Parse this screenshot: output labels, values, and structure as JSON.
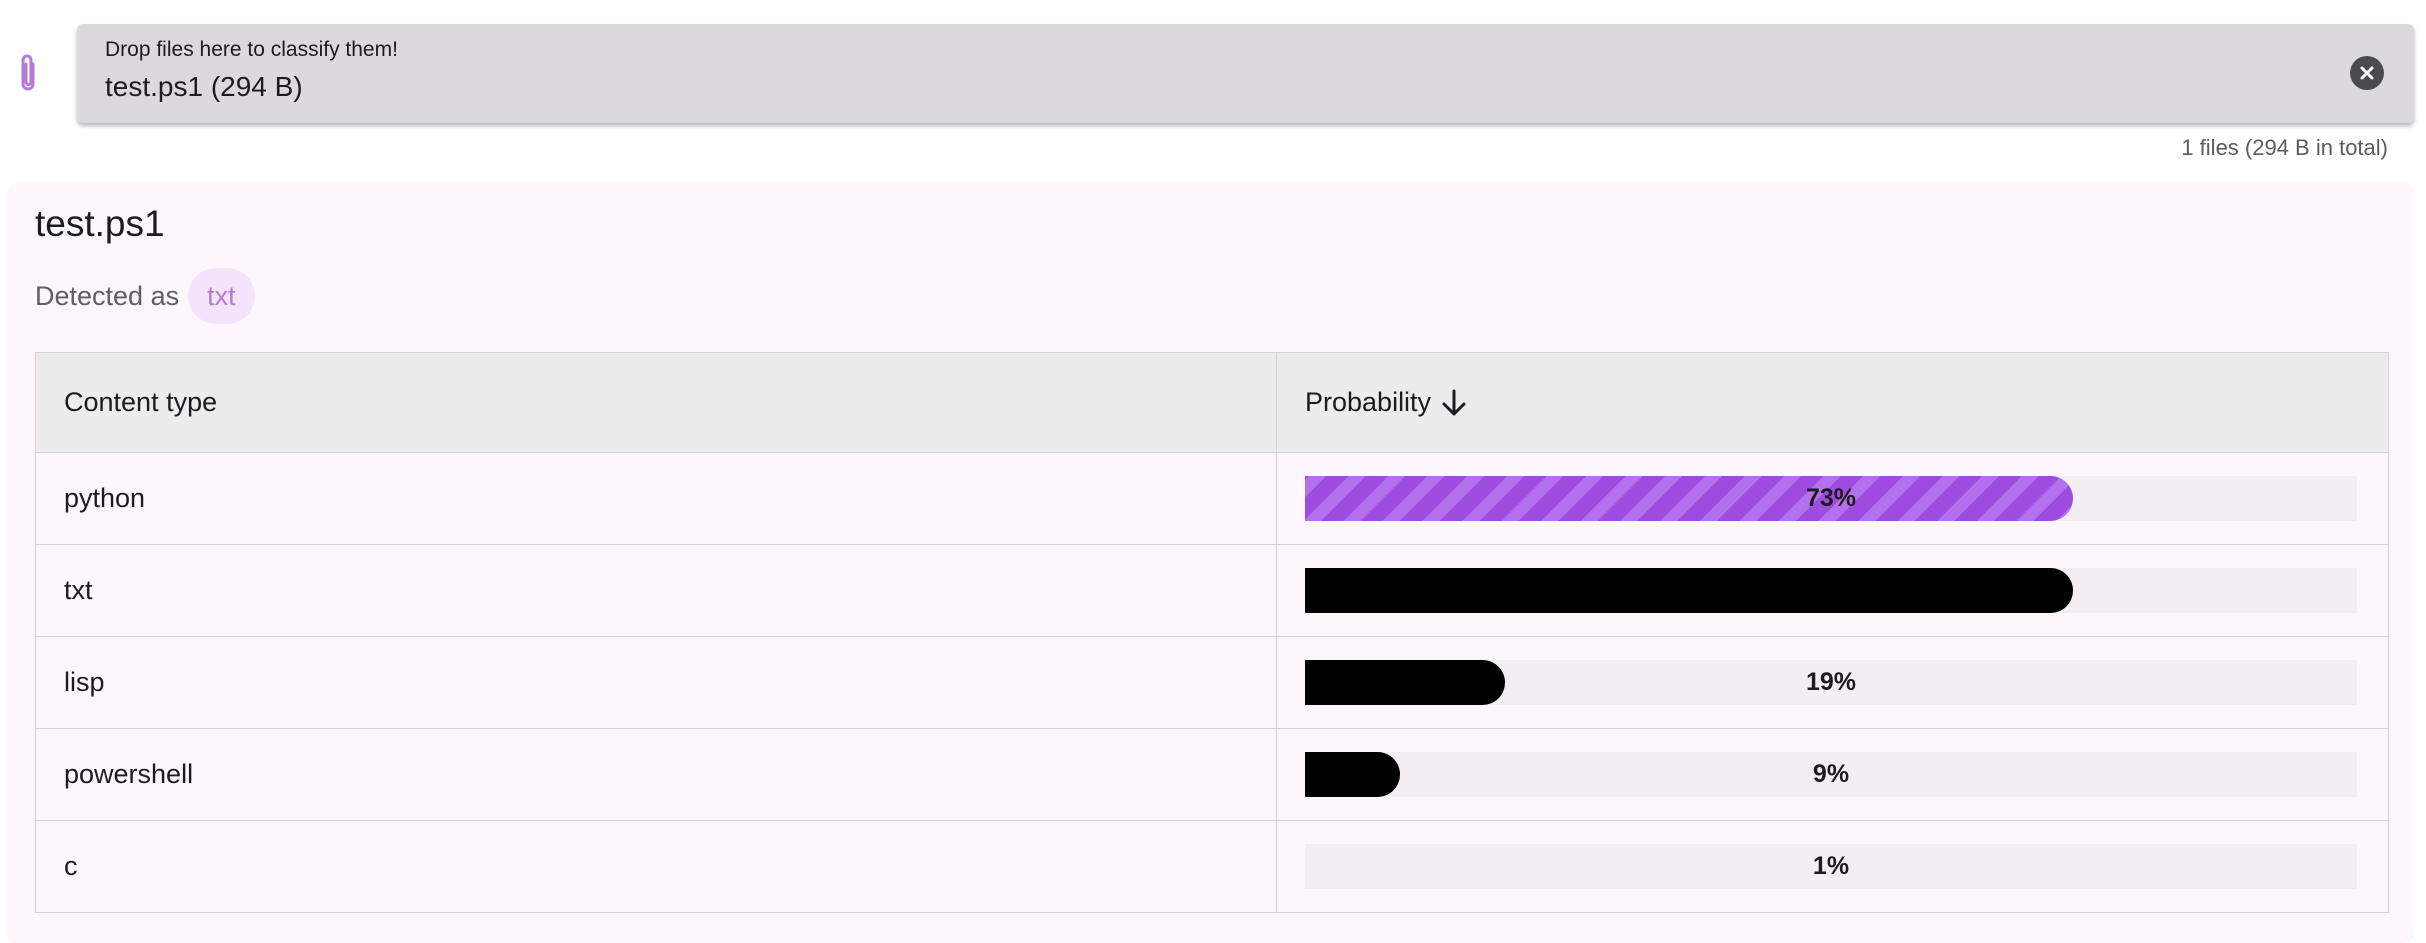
{
  "dropzone": {
    "hint": "Drop files here to classify them!",
    "file": "test.ps1 (294 B)",
    "summary": "1 files (294 B in total)"
  },
  "result": {
    "filename": "test.ps1",
    "detected_label": "Detected as",
    "detected_type": "txt"
  },
  "table": {
    "headers": {
      "content_type": "Content type",
      "probability": "Probability"
    },
    "rows": [
      {
        "type": "python",
        "probability": 73,
        "label": "73%",
        "style": "striped"
      },
      {
        "type": "txt",
        "probability": 73,
        "label": "",
        "style": "solid"
      },
      {
        "type": "lisp",
        "probability": 19,
        "label": "19%",
        "style": "solid"
      },
      {
        "type": "powershell",
        "probability": 9,
        "label": "9%",
        "style": "solid"
      },
      {
        "type": "c",
        "probability": 1,
        "label": "1%",
        "style": "solid"
      }
    ]
  },
  "icons": {
    "attach": "paperclip-icon",
    "clear": "close-circle-icon",
    "sort": "arrow-down-icon"
  },
  "colors": {
    "accent": "#9e4be0",
    "chip_bg": "#f4e4fb",
    "chip_text": "#b57ad4"
  }
}
